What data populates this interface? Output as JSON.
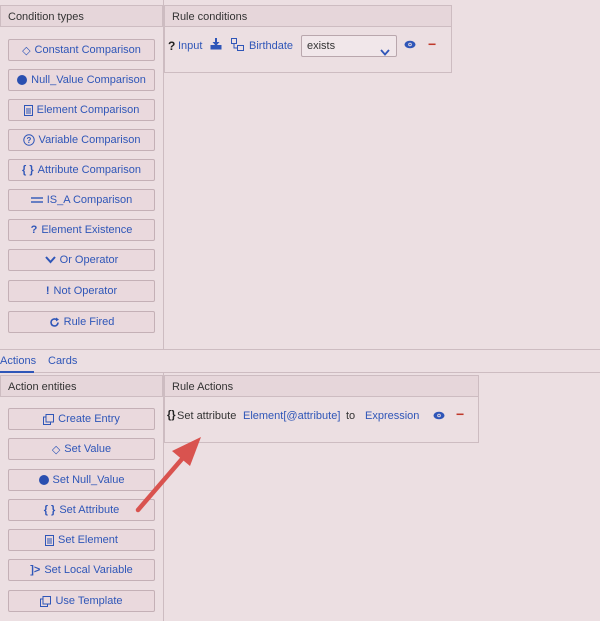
{
  "conditions": {
    "left_title": "Condition types",
    "right_title": "Rule conditions",
    "buttons": [
      {
        "label": "Constant Comparison",
        "icon": "diamond-icon"
      },
      {
        "label": "Null_Value Comparison",
        "icon": "filled-circle-icon"
      },
      {
        "label": "Element Comparison",
        "icon": "document-icon"
      },
      {
        "label": "Variable Comparison",
        "icon": "question-circle-icon"
      },
      {
        "label": "Attribute Comparison",
        "icon": "braces-icon"
      },
      {
        "label": "IS_A Comparison",
        "icon": "equals-arrows-icon"
      },
      {
        "label": "Element Existence",
        "icon": "question-mark-icon"
      },
      {
        "label": "Or Operator",
        "icon": "chevron-down-icon"
      },
      {
        "label": "Not Operator",
        "icon": "exclamation-icon"
      },
      {
        "label": "Rule Fired",
        "icon": "refresh-icon"
      }
    ],
    "rule": {
      "prefix_symbol": "?",
      "input_label": "Input",
      "element_label": "Birthdate",
      "operator_value": "exists"
    }
  },
  "tabs": [
    {
      "label": "Actions",
      "active": true
    },
    {
      "label": "Cards",
      "active": false
    }
  ],
  "actions": {
    "left_title": "Action entities",
    "right_title": "Rule Actions",
    "buttons": [
      {
        "label": "Create Entry",
        "icon": "copy-icon"
      },
      {
        "label": "Set Value",
        "icon": "diamond-icon"
      },
      {
        "label": "Set Null_Value",
        "icon": "filled-circle-icon"
      },
      {
        "label": "Set Attribute",
        "icon": "braces-icon"
      },
      {
        "label": "Set Element",
        "icon": "document-icon"
      },
      {
        "label": "Set Local Variable",
        "icon": "bracket-arrow-icon"
      },
      {
        "label": "Use Template",
        "icon": "copy-icon"
      }
    ],
    "rule": {
      "prefix": "{}",
      "text": "Set attribute",
      "target": "Element[@attribute]",
      "connector": "to",
      "expression": "Expression"
    }
  },
  "colors": {
    "background": "#ecdfe2",
    "link": "#2f56b8",
    "delete": "#c0392b",
    "arrow": "#d9534f"
  }
}
